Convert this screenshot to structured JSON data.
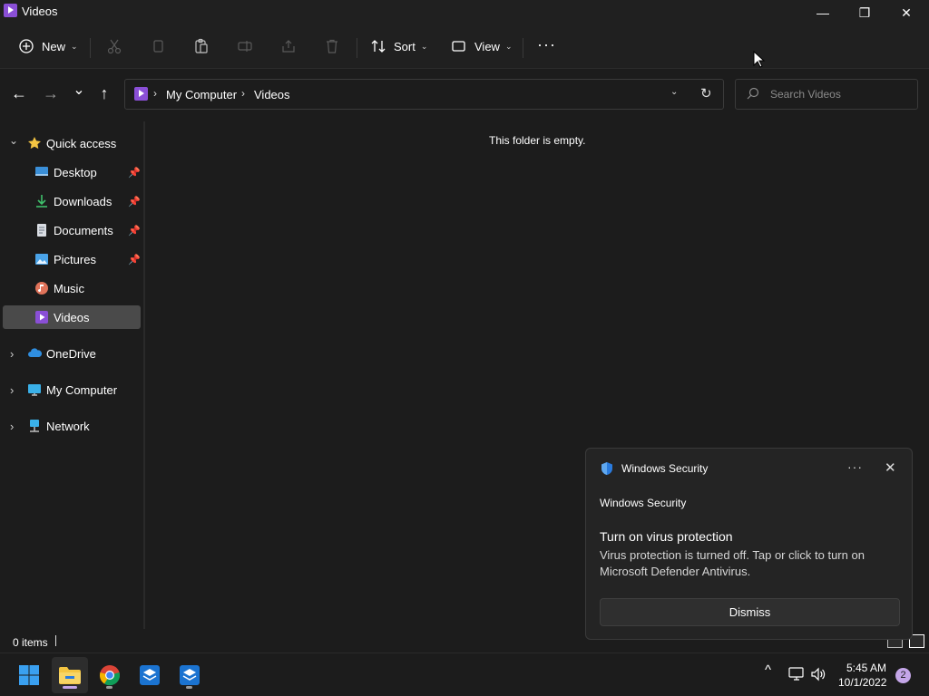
{
  "window": {
    "title": "Videos",
    "minimize_glyph": "—",
    "maximize_glyph": "❐",
    "close_glyph": "✕"
  },
  "commandbar": {
    "new_label": "New",
    "sort_label": "Sort",
    "view_label": "View",
    "more_label": "···",
    "icons": [
      "new-icon",
      "cut-icon",
      "copy-icon",
      "paste-icon",
      "rename-icon",
      "share-icon",
      "delete-icon",
      "sort-icon",
      "view-icon",
      "more-icon"
    ]
  },
  "navigation": {
    "back_glyph": "←",
    "forward_glyph": "→",
    "recent_glyph": "⌄",
    "up_glyph": "↑"
  },
  "address": {
    "breadcrumb": [
      "My Computer",
      "Videos"
    ],
    "separator": "›"
  },
  "search": {
    "placeholder": "Search Videos"
  },
  "sidebar": {
    "quick_access": "Quick access",
    "items": [
      {
        "label": "Desktop",
        "icon": "desktop-icon",
        "pinned": true
      },
      {
        "label": "Downloads",
        "icon": "download-icon",
        "pinned": true
      },
      {
        "label": "Documents",
        "icon": "documents-icon",
        "pinned": true
      },
      {
        "label": "Pictures",
        "icon": "pictures-icon",
        "pinned": true
      },
      {
        "label": "Music",
        "icon": "music-icon",
        "pinned": false
      },
      {
        "label": "Videos",
        "icon": "videos-icon",
        "pinned": false,
        "selected": true
      }
    ],
    "roots": [
      {
        "label": "OneDrive",
        "icon": "onedrive-icon"
      },
      {
        "label": "My Computer",
        "icon": "computer-icon"
      },
      {
        "label": "Network",
        "icon": "network-icon"
      }
    ]
  },
  "main": {
    "empty_message": "This folder is empty."
  },
  "statusbar": {
    "items_count": "0 items"
  },
  "toast": {
    "app_name": "Windows Security",
    "more_glyph": "···",
    "close_glyph": "✕",
    "source": "Windows Security",
    "heading": "Turn on virus protection",
    "body": "Virus protection is turned off. Tap or click to turn on Microsoft Defender Antivirus.",
    "dismiss_label": "Dismiss"
  },
  "taskbar": {
    "apps": [
      "start-icon",
      "file-explorer-icon",
      "chrome-icon",
      "store-app-icon",
      "store-app-icon"
    ],
    "time": "5:45 AM",
    "date": "10/1/2022",
    "notification_count": "2",
    "chevron_glyph": "^"
  },
  "colors": {
    "accent_purple": "#8a4fd6",
    "folder_yellow": "#f4c542",
    "shield_blue": "#2a7bde",
    "badge": "#c4a6e8"
  }
}
